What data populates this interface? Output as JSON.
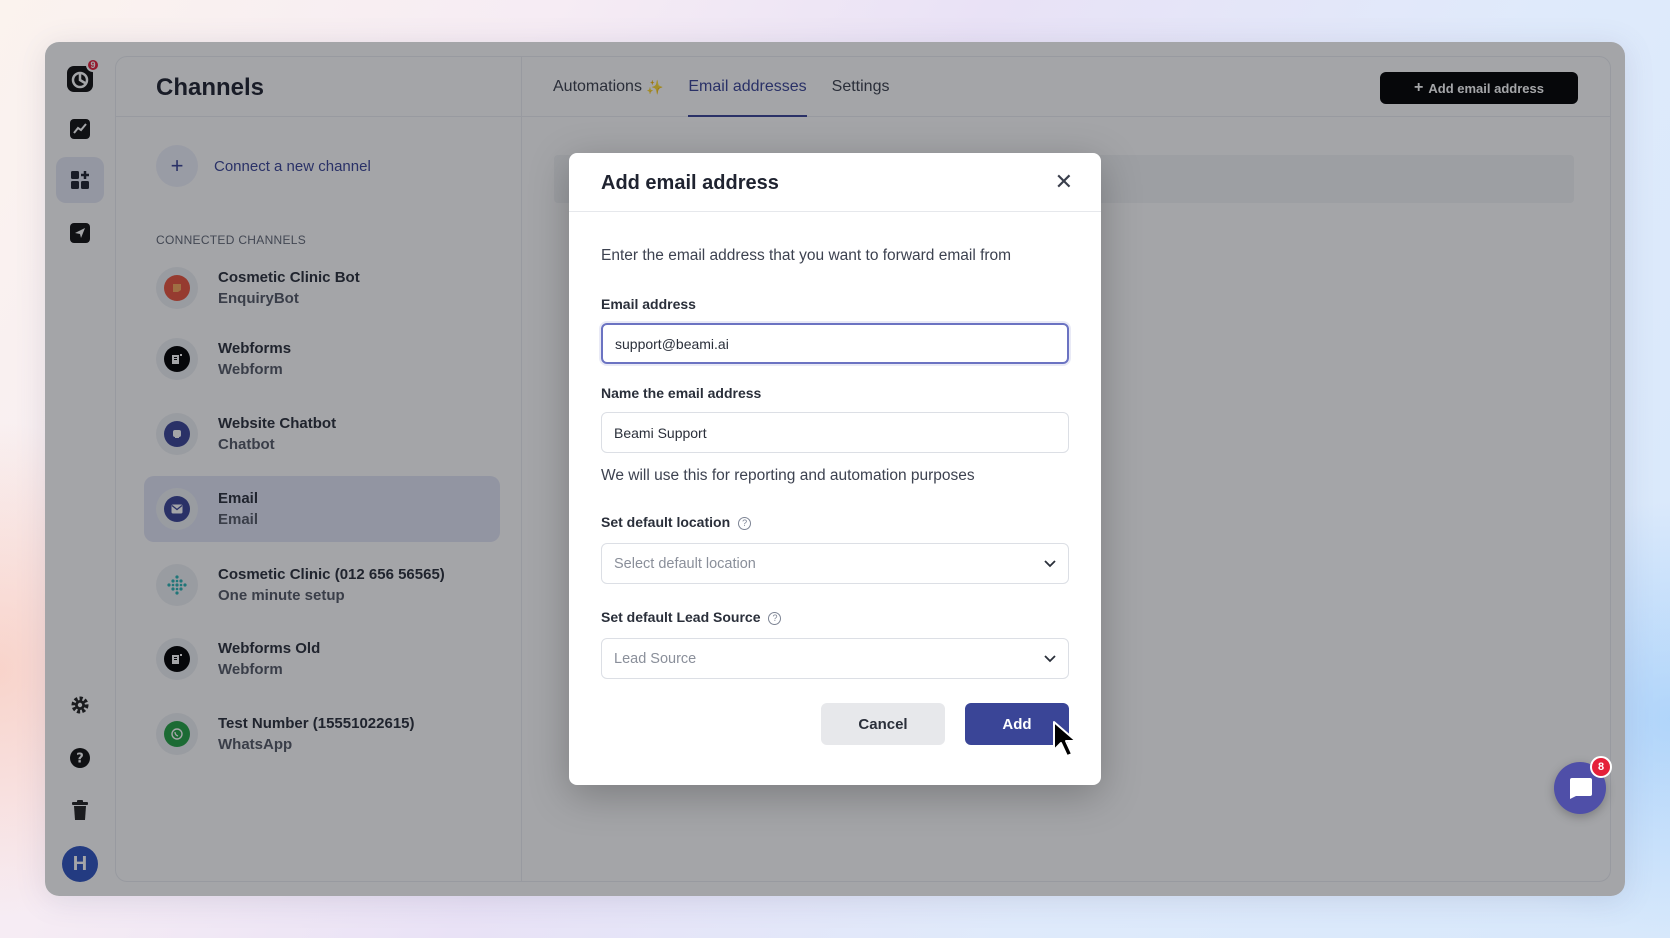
{
  "app": {
    "logo_badge": "9",
    "avatar_initial": "H",
    "chat_badge": "8"
  },
  "header": {
    "title": "Channels",
    "tabs": [
      {
        "label": "Automations",
        "extra": "✨"
      },
      {
        "label": "Email addresses"
      },
      {
        "label": "Settings"
      }
    ],
    "add_button": "Add email address"
  },
  "sidebar": {
    "connect_label": "Connect a new channel",
    "section_label": "CONNECTED CHANNELS",
    "channels": [
      {
        "name": "Cosmetic Clinic Bot",
        "sub": "EnquiryBot",
        "icon": "bot-icon",
        "color": "#e8553e"
      },
      {
        "name": "Webforms",
        "sub": "Webform",
        "icon": "webform-icon",
        "color": "#000000"
      },
      {
        "name": "Website Chatbot",
        "sub": "Chatbot",
        "icon": "chatbot-icon",
        "color": "#3a4597"
      },
      {
        "name": "Email",
        "sub": "Email",
        "icon": "mail-icon",
        "color": "#3a4597"
      },
      {
        "name": "Cosmetic Clinic (012 656 56565)",
        "sub": "One minute setup",
        "icon": "diamond-grid-icon",
        "color": "#2bb3b3"
      },
      {
        "name": "Webforms Old",
        "sub": "Webform",
        "icon": "webform-icon",
        "color": "#000000"
      },
      {
        "name": "Test Number (15551022615)",
        "sub": "WhatsApp",
        "icon": "whatsapp-icon",
        "color": "#25a244"
      }
    ]
  },
  "modal": {
    "title": "Add email address",
    "description": "Enter the email address that you want to forward email from",
    "email_label": "Email address",
    "email_value": "support@beami.ai",
    "name_label": "Name the email address",
    "name_value": "Beami Support",
    "name_hint": "We will use this for reporting and automation purposes",
    "location_label": "Set default location",
    "location_placeholder": "Select default location",
    "lead_label": "Set default Lead Source",
    "lead_placeholder": "Lead Source",
    "cancel": "Cancel",
    "add": "Add"
  }
}
